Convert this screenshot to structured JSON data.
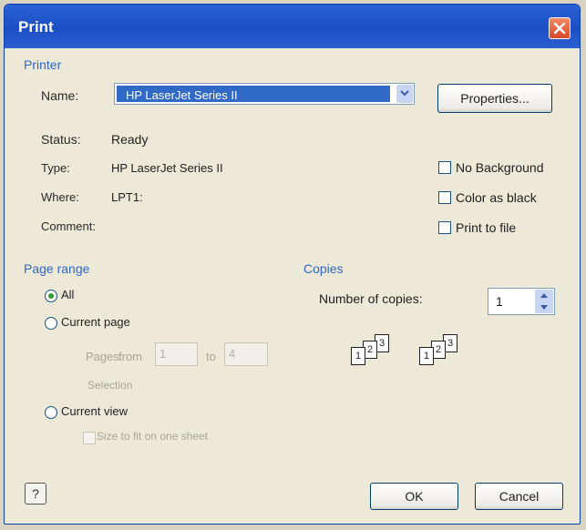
{
  "window": {
    "title": "Print"
  },
  "printer": {
    "section_label": "Printer",
    "name_label": "Name:",
    "name_value": "HP LaserJet Series II",
    "properties_label": "Properties...",
    "status_label": "Status:",
    "status_value": "Ready",
    "type_label": "Type:",
    "type_value": "HP LaserJet Series II",
    "where_label": "Where:",
    "where_value": "LPT1:",
    "comment_label": "Comment:",
    "no_background_label": "No Background",
    "color_as_black_label": "Color as black",
    "print_to_file_label": "Print to file"
  },
  "page_range": {
    "section_label": "Page range",
    "all_label": "All",
    "current_page_label": "Current page",
    "pages_label": "Pages:",
    "from_label": "from",
    "from_value": "1",
    "to_label": "to",
    "to_value": "4",
    "selection_label": "Selection",
    "current_view_label": "Current view",
    "size_to_fit_label": "Size to fit on one sheet"
  },
  "copies": {
    "section_label": "Copies",
    "number_label": "Number of copies:",
    "number_value": "1",
    "collate_pages": [
      "1",
      "2",
      "3"
    ]
  },
  "buttons": {
    "ok_label": "OK",
    "cancel_label": "Cancel",
    "help_glyph": "?"
  },
  "colors": {
    "title_bar": "#1f54c9",
    "section_label": "#3167c4",
    "selected": "#3169c6"
  },
  "icons": {
    "close": "close-icon",
    "combo_arrow": "chevron-down-icon",
    "help": "help-icon"
  }
}
